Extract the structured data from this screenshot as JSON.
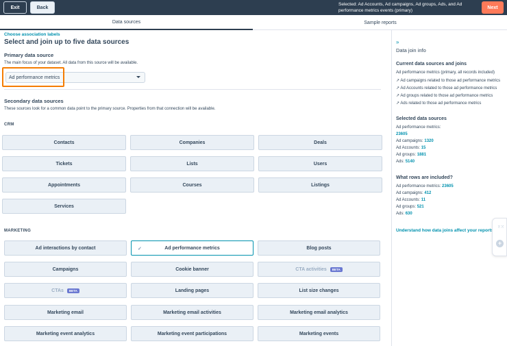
{
  "topbar": {
    "exit_label": "Exit",
    "back_label": "Back",
    "selected_line1": "Selected: Ad Accounts, Ad campaigns, Ad groups, Ads, and Ad",
    "selected_line2": "performance metrics events (primary)",
    "next_label": "Next"
  },
  "tabs": {
    "data_sources": "Data sources",
    "sample_reports": "Sample reports"
  },
  "main": {
    "assoc_link": "Choose association labels",
    "title": "Select and join up to five data sources",
    "primary": {
      "heading": "Primary data source",
      "desc": "The main focus of your dataset. All data from this source will be available.",
      "selected": "Ad performance metrics"
    },
    "secondary": {
      "heading": "Secondary data sources",
      "desc": "These sources look for a common data point to the primary source. Properties from that connection will be available."
    },
    "crm": {
      "label": "CRM",
      "tiles": [
        "Contacts",
        "Companies",
        "Deals",
        "Tickets",
        "Lists",
        "Users",
        "Appointments",
        "Courses",
        "Listings",
        "Services"
      ]
    },
    "marketing": {
      "label": "MARKETING",
      "tiles": [
        "Ad interactions by contact",
        "Ad performance metrics",
        "Blog posts",
        "Campaigns",
        "Cookie banner",
        "CTA activities",
        "CTAs",
        "Landing pages",
        "List size changes",
        "Marketing email",
        "Marketing email activities",
        "Marketing email analytics",
        "Marketing event analytics",
        "Marketing event participations",
        "Marketing events"
      ],
      "beta_label": "BETA"
    }
  },
  "side": {
    "title": "Data join info",
    "current_heading": "Current data sources and joins",
    "current_items": [
      "Ad performance metrics (primary, all records included)",
      "↗ Ad campaigns related to those ad performance metrics",
      "↗ Ad Accounts related to those ad performance metrics",
      "↗ Ad groups related to those ad performance metrics",
      "↗ Ads related to those ad performance metrics"
    ],
    "selected_heading": "Selected data sources",
    "selected": {
      "apm_label": "Ad performance metrics:",
      "apm_value": "23605",
      "campaigns_label": "Ad campaigns:",
      "campaigns_value": "1320",
      "accounts_label": "Ad Accounts:",
      "accounts_value": "15",
      "groups_label": "Ad groups:",
      "groups_value": "1881",
      "ads_label": "Ads:",
      "ads_value": "5140"
    },
    "rows_heading": "What rows are included?",
    "rows": {
      "apm_label": "Ad performance metrics:",
      "apm_value": "23605",
      "campaigns_label": "Ad campaigns:",
      "campaigns_value": "412",
      "accounts_label": "Ad Accounts:",
      "accounts_value": "11",
      "groups_label": "Ad groups:",
      "groups_value": "521",
      "ads_label": "Ads:",
      "ads_value": "630"
    },
    "understand_link": "Understand how data joins affect your reports."
  },
  "icons": {
    "collapse": "double-chevron-right-icon",
    "check": "check-icon",
    "caret": "caret-down-icon",
    "grid": "grid-icon",
    "plus": "plus-icon"
  },
  "colors": {
    "topbar": "#2d3e50",
    "accent": "#0091ae",
    "next": "#ff7a59",
    "highlight": "#f57c00"
  }
}
